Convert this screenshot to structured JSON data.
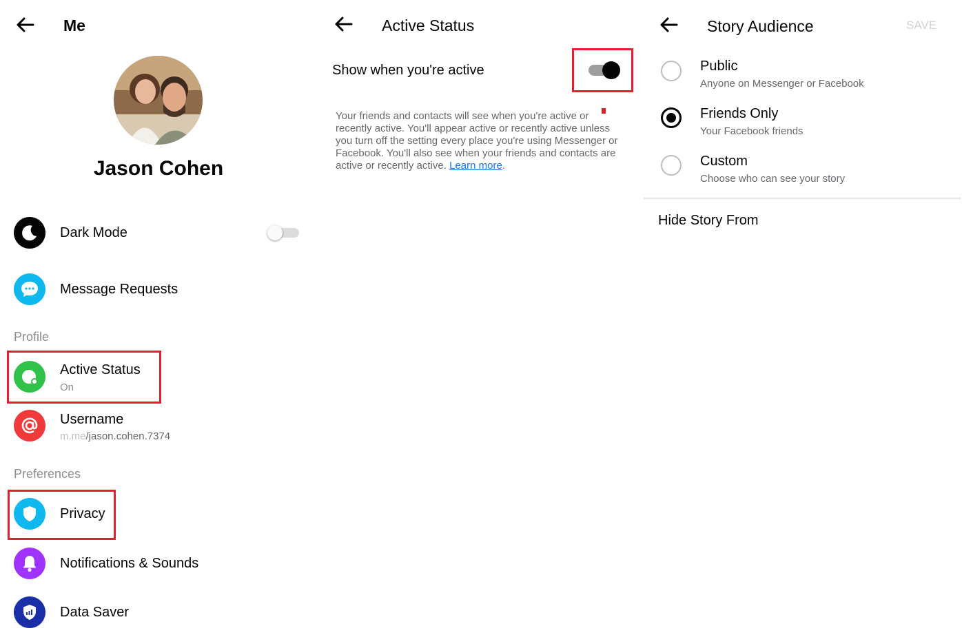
{
  "me": {
    "title": "Me",
    "name": "Jason Cohen",
    "dark_mode": {
      "label": "Dark Mode"
    },
    "message_requests": {
      "label": "Message Requests"
    },
    "profile_section": "Profile",
    "active_status": {
      "label": "Active Status",
      "sub": "On"
    },
    "username": {
      "label": "Username",
      "domain": "m.me",
      "path": "/jason.cohen.7374"
    },
    "preferences_section": "Preferences",
    "privacy": {
      "label": "Privacy"
    },
    "notifications": {
      "label": "Notifications & Sounds"
    },
    "data_saver": {
      "label": "Data Saver"
    }
  },
  "active_status_screen": {
    "title": "Active Status",
    "toggle_label": "Show when you're active",
    "description": "Your friends and contacts will see when you're active or recently active. You'll appear active or recently active unless you turn off the setting every place you're using Messenger or Facebook. You'll also see when your friends and contacts are active or recently active.",
    "learn_more": "Learn more",
    "period": "."
  },
  "story_audience": {
    "title": "Story Audience",
    "save": "SAVE",
    "options": [
      {
        "label": "Public",
        "sub": "Anyone on Messenger or Facebook",
        "selected": false
      },
      {
        "label": "Friends Only",
        "sub": "Your Facebook friends",
        "selected": true
      },
      {
        "label": "Custom",
        "sub": "Choose who can see your story",
        "selected": false
      }
    ],
    "hide_from": "Hide Story From"
  },
  "colors": {
    "highlight": "#e5202e",
    "active_green": "#31c24a",
    "messenger_blue": "#0fb9f0",
    "username_red": "#f0393a",
    "notifications_purple": "#a033ff",
    "data_saver_navy": "#1a2ea8",
    "link_blue": "#1a73e8"
  }
}
